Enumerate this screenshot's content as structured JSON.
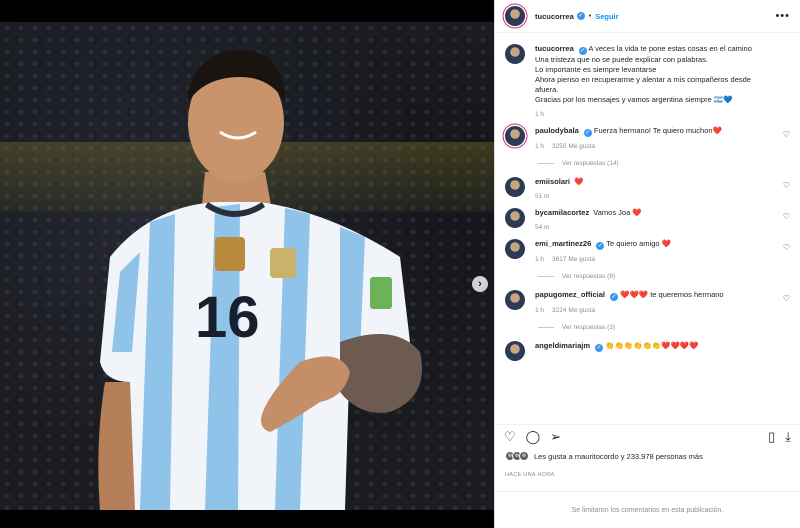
{
  "post": {
    "author": "tucucorrea",
    "separator": "•",
    "follow_label": "Seguir",
    "more_label": "•••",
    "caption_lines": [
      "A veces la vida te pone estas cosas en el camino",
      "Una tristeza que no se puede explicar con palabras.",
      "Lo importante es siempre levantarse",
      "Ahora pienso en recuperarme y alentar a mis compañeros desde afuera.",
      "Gracias por los mensajes y vamos argentina siempre 🇦🇷💙"
    ],
    "caption_time": "1 h"
  },
  "comments": [
    {
      "user": "paulodybala",
      "verified": true,
      "text": "Fuerza hermano! Te quiero muchon",
      "emoji": "❤️",
      "time": "1 h",
      "likes": "3250 Me gusta",
      "replies": "Ver respuestas (14)"
    },
    {
      "user": "emiisolari",
      "verified": false,
      "text": "",
      "emoji": "❤️",
      "time": "51 m",
      "likes": "",
      "replies": ""
    },
    {
      "user": "bycamilacortez",
      "verified": false,
      "text": "Vamos Joa",
      "emoji": "❤️",
      "time": "54 m",
      "likes": "",
      "replies": ""
    },
    {
      "user": "emi_martinez26",
      "verified": true,
      "text": "Te quiero amigo",
      "emoji": "❤️",
      "time": "1 h",
      "likes": "3617 Me gusta",
      "replies": "Ver respuestas (8)"
    },
    {
      "user": "papugomez_official",
      "verified": true,
      "text": "te queremos hermano",
      "emoji": "❤️❤️❤️",
      "time": "1 h",
      "likes": "3224 Me gusta",
      "replies": "Ver respuestas (3)"
    },
    {
      "user": "angeldimariajm",
      "verified": true,
      "text": "",
      "emoji": "👏👏👏👏👏👏❤️❤️❤️❤️",
      "time": "",
      "likes": "",
      "replies": ""
    }
  ],
  "likes_text": "Les gusta a mauritocordo y 233.978 personas más",
  "time_ago": "HACE UNA HORA",
  "comments_limited": "Se limitaron los comentarios en esta publicación.",
  "icons": {
    "heart": "heart-icon",
    "comment": "comment-icon",
    "share": "share-icon",
    "save": "bookmark-icon",
    "download": "download-icon"
  }
}
